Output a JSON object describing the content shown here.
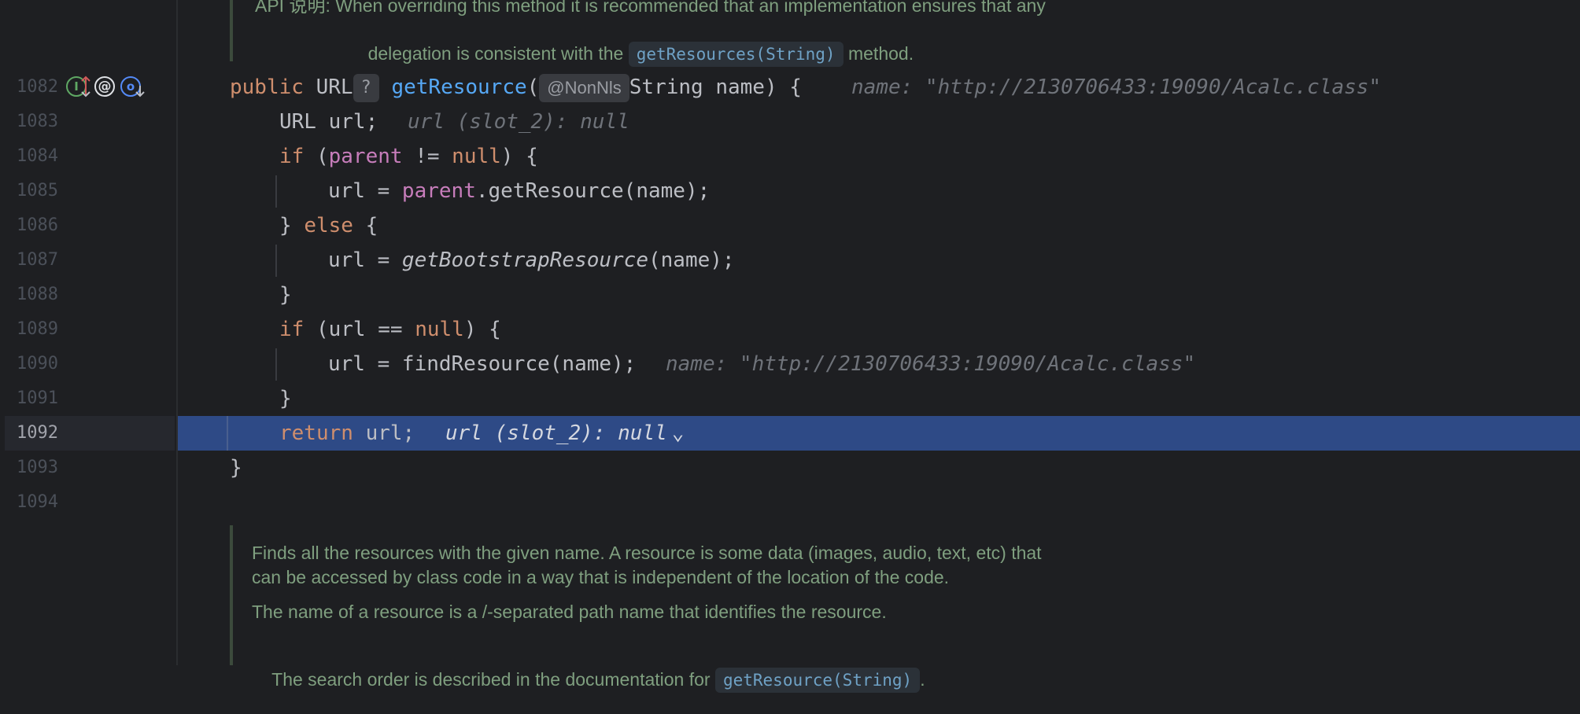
{
  "gutter": {
    "line_numbers": [
      "1082",
      "1083",
      "1084",
      "1085",
      "1086",
      "1087",
      "1088",
      "1089",
      "1090",
      "1091",
      "1092",
      "1093",
      "1094"
    ],
    "current_line": "1092",
    "icons": [
      "implementation-override-icon",
      "annotation-icon",
      "overridden-method-icon"
    ]
  },
  "doc_top": {
    "line1": "API 说明: When overriding this method it is recommended that an implementation ensures that any",
    "line2_pre": "delegation is consistent with the ",
    "line2_code": "getResources(String)",
    "line2_post": " method."
  },
  "code": {
    "l1082": {
      "kw": "public",
      "type": "URL",
      "chip": "?",
      "method": "getResource",
      "paren": "(",
      "anno": "@NonNls",
      "params": "String name) {",
      "hint": "name: \"http://2130706433:19090/Acalc.class\""
    },
    "l1083": {
      "text": "URL url;",
      "hint": "url (slot_2): null"
    },
    "l1084": {
      "kw": "if",
      "open": " (",
      "field": "parent",
      "rest_pre": " != ",
      "kw2": "null",
      "rest": ") {"
    },
    "l1085": {
      "pre": "url = ",
      "field": "parent",
      "rest": ".getResource(name);"
    },
    "l1086": {
      "brace": "} ",
      "kw": "else",
      "rest": " {"
    },
    "l1087": {
      "pre": "url = ",
      "italic": "getBootstrapResource",
      "rest": "(name);"
    },
    "l1088": {
      "text": "}"
    },
    "l1089": {
      "kw": "if",
      "open": " (url == ",
      "kw2": "null",
      "rest": ") {"
    },
    "l1090": {
      "text": "url = findResource(name);",
      "hint": "name: \"http://2130706433:19090/Acalc.class\""
    },
    "l1091": {
      "text": "}"
    },
    "l1092": {
      "kw": "return",
      "rest": " url;",
      "hint": "url (slot_2): null",
      "chev": "⌄"
    },
    "l1093": {
      "text": "}"
    }
  },
  "doc_bottom": {
    "p1_line1": "Finds all the resources with the given name. A resource is some data (images, audio, text, etc) that",
    "p1_line2": "can be accessed by class code in a way that is independent of the location of the code.",
    "p2": "The name of a resource is a /-separated path name that identifies the resource.",
    "p3_pre": "The search order is described in the documentation for ",
    "p3_code": "getResource(String)",
    "p3_post": "."
  },
  "colors": {
    "background": "#1e1f22",
    "keyword": "#cf8e6d",
    "field": "#c77dbb",
    "method": "#56a8f5",
    "highlight": "#2e4a86",
    "doc_text": "#7f9f7f"
  }
}
